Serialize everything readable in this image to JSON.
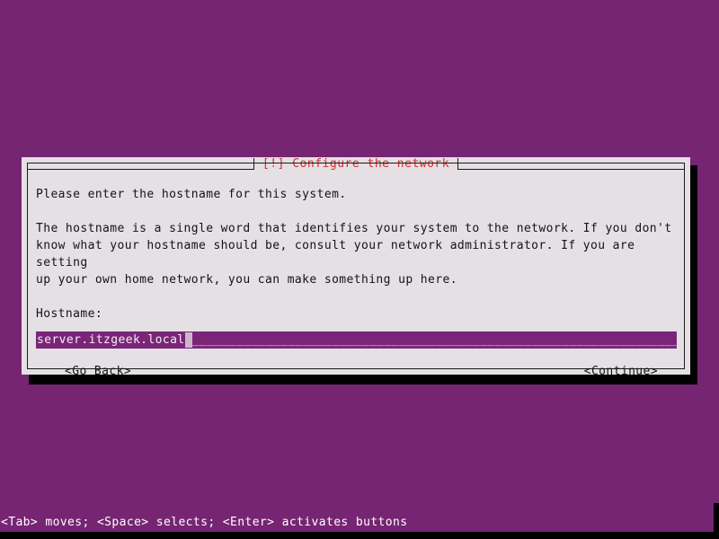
{
  "screen": {
    "background_color": "#762572",
    "text_color": "#ffffff"
  },
  "dialog": {
    "title": "[!] Configure the network",
    "title_color": "#d22d2d",
    "panel_color": "#e4e0e4",
    "border_color": "#1a1a1a",
    "intro_text": "Please enter the hostname for this system.",
    "description_text": "The hostname is a single word that identifies your system to the network. If you don't\nknow what your hostname should be, consult your network administrator. If you are setting\nup your own home network, you can make something up here.",
    "field": {
      "label": "Hostname:",
      "value": "server.itzgeek.local",
      "fill_char": "_",
      "field_color": "#7a2578",
      "value_color": "#f2eef2",
      "cursor_color": "#cdb6cd"
    },
    "buttons": {
      "back_label": "<Go Back>",
      "continue_label": "<Continue>"
    }
  },
  "status_bar": {
    "hint": "<Tab> moves; <Space> selects; <Enter> activates buttons"
  }
}
